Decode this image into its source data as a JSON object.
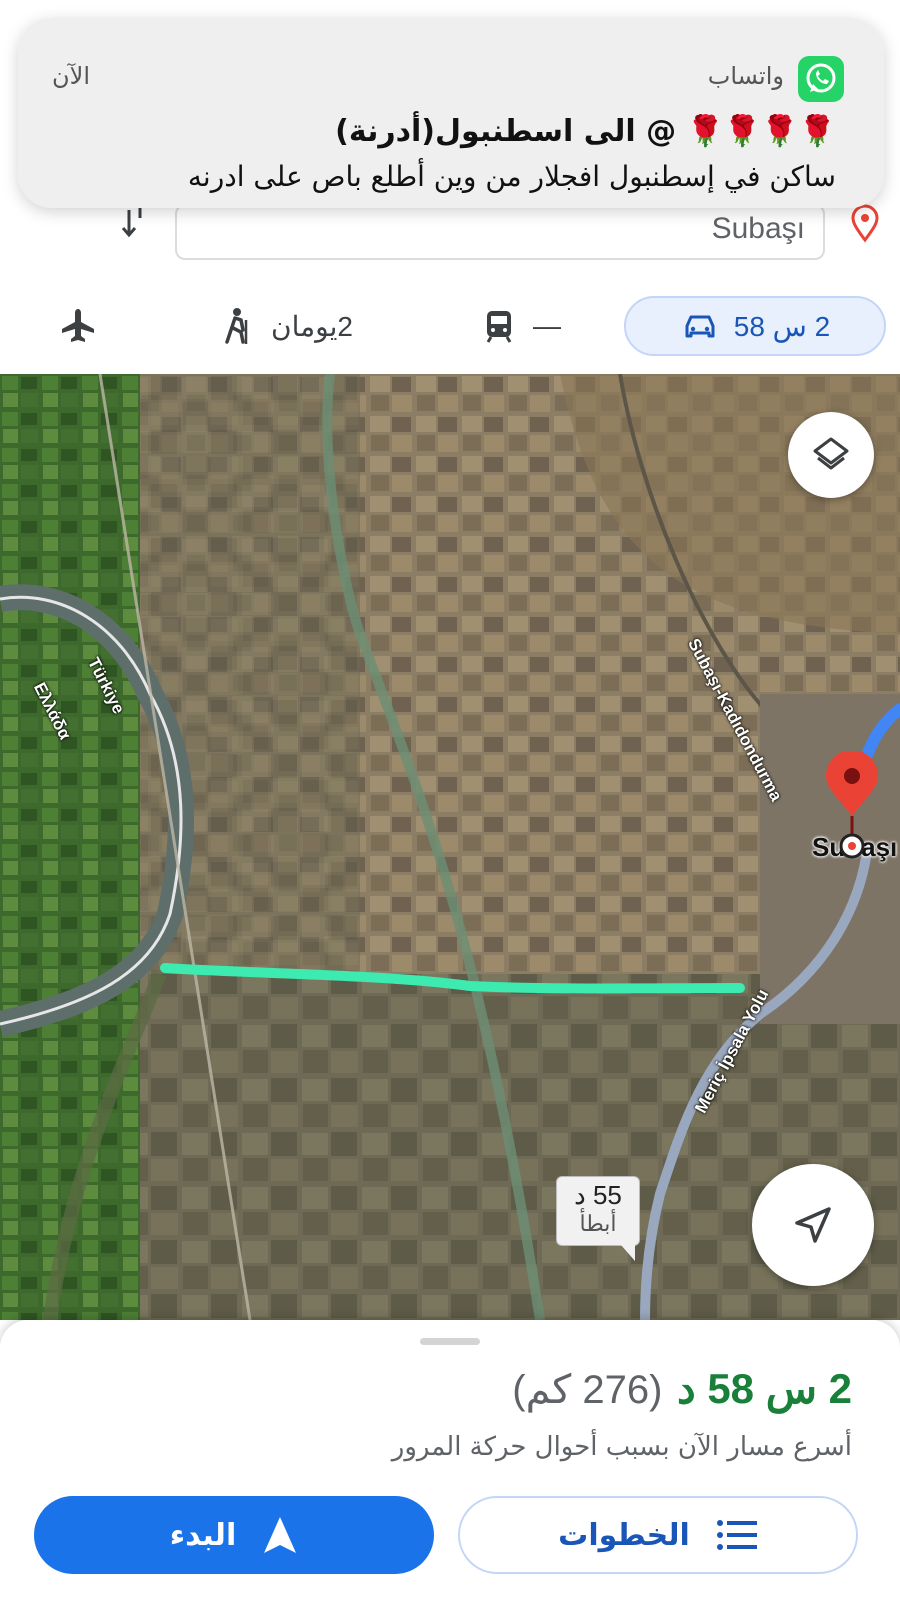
{
  "notification": {
    "app_name": "واتساب",
    "time": "الآن",
    "title": "🌹🌹🌹🌹 @ الى اسطنبول(أدرنة)",
    "body": "ساكن في إسطنبول افجلار من وين أطلع باص على ادرنه",
    "colors": {
      "whatsapp_green": "#25d366"
    },
    "icon": "whatsapp-icon"
  },
  "directions": {
    "destination_value": "Subaşı",
    "destination_icon": "location-pin-outline-icon",
    "swap_icon": "swap-arrows-icon"
  },
  "travel_modes": [
    {
      "mode": "drive",
      "icon": "car-icon",
      "label": "2 س 58",
      "selected": true
    },
    {
      "mode": "transit",
      "icon": "train-icon",
      "label": "—",
      "selected": false
    },
    {
      "mode": "walk",
      "icon": "hiker-icon",
      "label": "2يومان",
      "selected": false
    },
    {
      "mode": "flight",
      "icon": "airplane-icon",
      "label": "",
      "selected": false
    }
  ],
  "map": {
    "labels": {
      "turkiye": "Türkiye",
      "greece": "Ελλάδα",
      "road_kadidondurma": "Subaşı-Kadıdondurma",
      "road_meric": "Meriç İpsala Yolu",
      "town": "Subaşı"
    },
    "route_time_bubble": {
      "time": "55 د",
      "note": "أبطأ"
    },
    "colors": {
      "route_blue": "#4285f4",
      "alt_route_gray": "#9aa8bf",
      "annotation_line": "#3deab0",
      "pin_red": "#ea4335"
    },
    "controls": {
      "layers_icon": "layers-icon",
      "locate_icon": "navigation-arrow-icon"
    }
  },
  "route_summary": {
    "duration": "2 س 58 د",
    "distance": "(276 كم)",
    "note": "أسرع مسار الآن بسبب أحوال حركة المرور",
    "start_label": "البدء",
    "steps_label": "الخطوات",
    "colors": {
      "duration_green": "#188038",
      "primary_blue": "#1a73e8"
    }
  }
}
